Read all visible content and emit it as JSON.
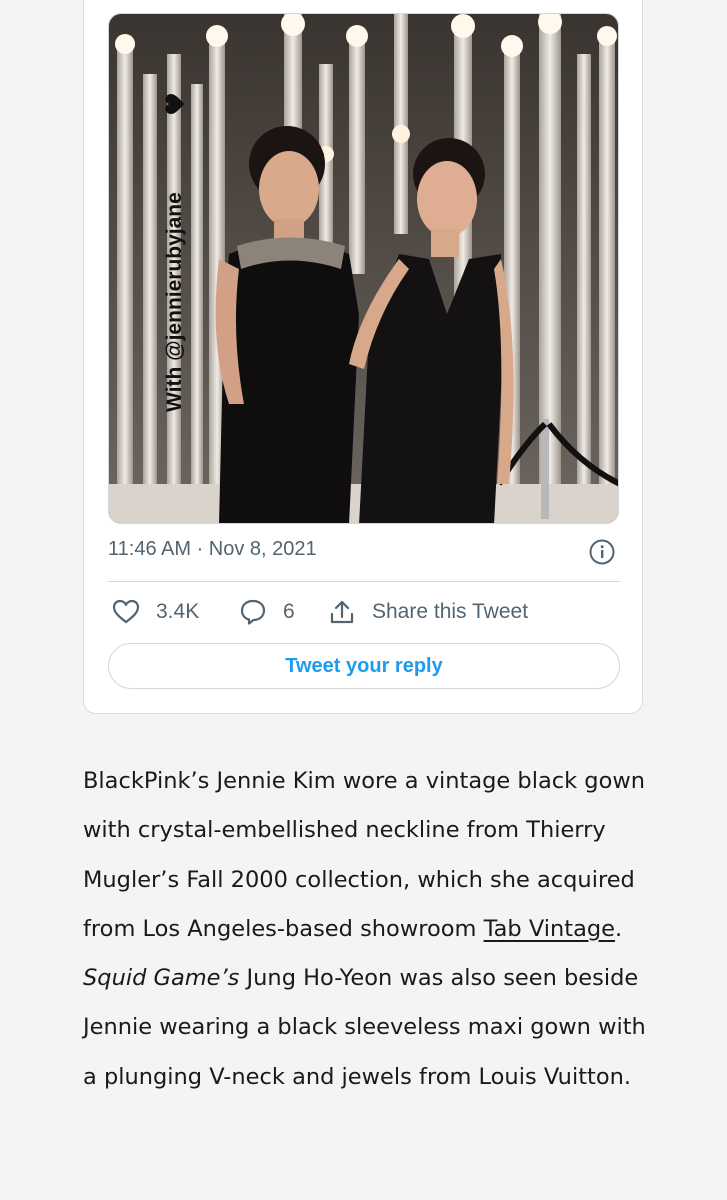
{
  "tweet": {
    "photo_caption": "With @jennierubyjane",
    "timestamp": "11:46 AM · Nov 8, 2021",
    "likes": "3.4K",
    "replies": "6",
    "share_label": "Share this Tweet",
    "reply_button_label": "Tweet your reply",
    "icons": {
      "like": "heart-icon",
      "reply": "comment-icon",
      "share": "share-icon",
      "info": "info-icon"
    }
  },
  "article": {
    "line1": "BlackPink’s Jennie Kim wore a vintage black gown with crystal-embellished neckline from Thierry Mugler’s Fall 2000 collection, which she acquired from Los Angeles-based showroom",
    "link_text": "Tab Vintage",
    "after_link": ".",
    "italic_text": "Squid Game’s",
    "rest": "Jung Ho-Yeon was also seen beside Jennie wearing a black sleeveless maxi gown with a plunging V-neck and jewels from Louis Vuitton."
  },
  "colors": {
    "accent": "#1d9bf0",
    "muted": "#536471",
    "text": "#1a1a1a",
    "background": "#f4f4f4"
  }
}
